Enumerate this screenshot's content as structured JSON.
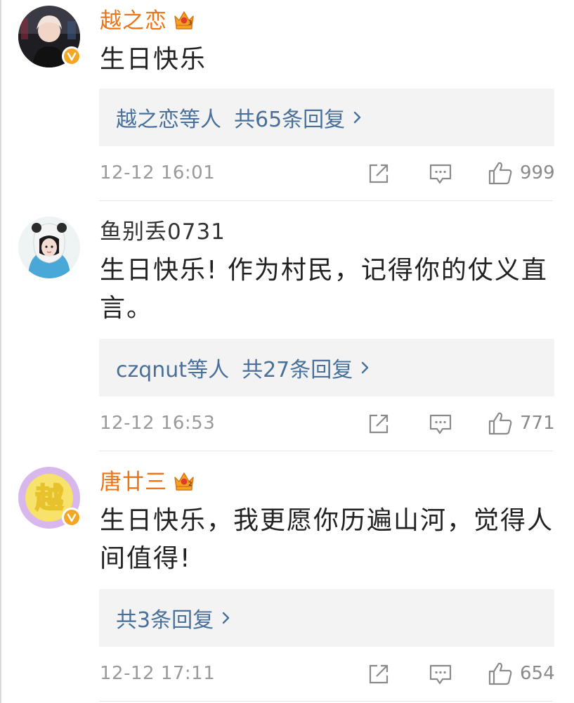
{
  "comments": [
    {
      "user": "越之恋",
      "text": "生日快乐",
      "reply_who": "越之恋等人",
      "reply_label": "共65条回复",
      "time": "12-12 16:01",
      "likes": "999"
    },
    {
      "user": "鱼别丢0731",
      "text": "生日快乐! 作为村民，记得你的仗义直言。",
      "reply_who": "czqnut等人",
      "reply_label": "共27条回复",
      "time": "12-12 16:53",
      "likes": "771"
    },
    {
      "user": "唐廿三",
      "text": "生日快乐，我更愿你历遍山河，觉得人间值得!",
      "reply_who": "",
      "reply_label": "共3条回复",
      "time": "12-12 17:11",
      "likes": "654"
    }
  ],
  "avatar_3_glyph": "越",
  "colors": {
    "vip_name": "#eb7419",
    "link": "#48709b",
    "meta": "#9a9a9a",
    "reply_bg": "#f3f3f3",
    "verified_badge": "#f5a623"
  },
  "icons": [
    "verified-icon",
    "vip-crown-icon",
    "chevron-right-icon",
    "share-icon",
    "comment-icon",
    "like-icon"
  ]
}
